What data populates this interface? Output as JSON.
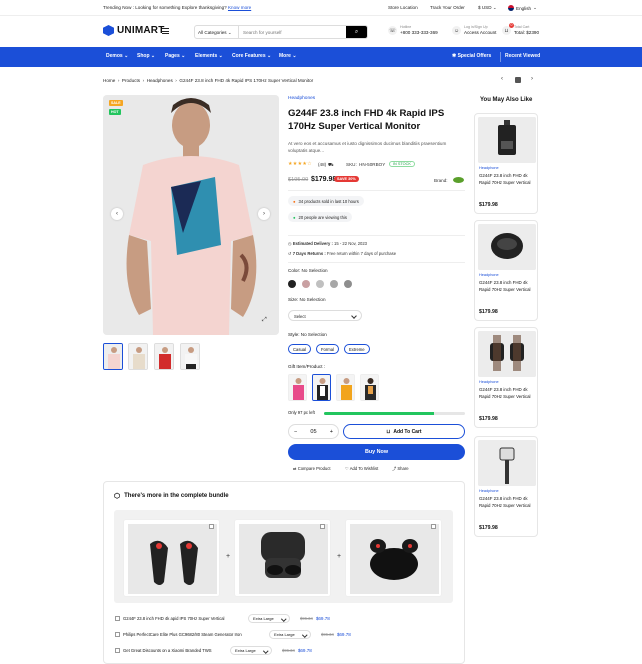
{
  "topbar": {
    "trending": "Trending Now : Looking for something Explore thanksgiving?",
    "know_more": "Know more",
    "store_location": "Store Location",
    "track_order": "Track Your Order",
    "currency": "$ USD",
    "language": "English"
  },
  "header": {
    "logo": "UNIMART",
    "search_category": "All Categories",
    "search_placeholder": "Search for yourself",
    "hotline_label": "Hotline",
    "hotline_value": "+800 333-333-369",
    "account_label": "Log in/Sign Up",
    "account_value": "Access Account",
    "cart_label": "Total Cart",
    "cart_value": "Total: $2390",
    "cart_count": "0"
  },
  "nav": {
    "items": [
      "Demos",
      "Shop",
      "Pages",
      "Elements",
      "Core Features",
      "More"
    ],
    "special_offers": "Special Offers",
    "recent_viewed": "Recent Viewed"
  },
  "breadcrumb": [
    "Home",
    "Products",
    "Headphones",
    "G244F 23.8 inch FHD 4k Rapid IPS 170Hz Super Vertical Monitor"
  ],
  "gallery": {
    "tag_sale": "SALE",
    "tag_hot": "HOT"
  },
  "product": {
    "category": "Headphones",
    "title": "G244F 23.8 inch FHD 4k Rapid IPS 170Hz Super Vertical Monitor",
    "description": "At vero eos et accusamus et iusto dignissimos ducimus blanditiis praesentium voluptatis atque...",
    "rating_stars": "★★★★☆",
    "rating_count": "(48)",
    "sku_label": "SKU:",
    "sku": "HN-50RBOY",
    "stock": "IN STOCK",
    "old_price": "$195.00",
    "price": "$179.98",
    "save": "SAVE 30%",
    "brand_label": "Brand:",
    "sold_text": "34 products sold in last 10 hours",
    "viewing_text": "20 people are viewing this",
    "delivery_label": "Estimated Delivery :",
    "delivery_value": "15 - 22 Nov, 2023",
    "returns_label": "7 Days Returns :",
    "returns_value": "Free return within 7 days of purchase",
    "color_label": "Color:",
    "color_value": "No Selection",
    "colors": [
      "#222222",
      "#c9a0a2",
      "#c0c0c0",
      "#a7a7a7",
      "#8e8e8e"
    ],
    "size_label": "Size:",
    "size_value": "No Selection",
    "size_select": "Select",
    "style_label": "Style:",
    "style_value": "No Selection",
    "styles": [
      "Casual",
      "Formal",
      "Extreme"
    ],
    "gift_label": "Gift Item/Product :",
    "stock_left": "Only 97 pc left",
    "stock_progress": 0.78,
    "qty": "05",
    "add_to_cart": "Add To Cart",
    "buy_now": "Buy Now",
    "compare": "Compare Product",
    "wishlist": "Add To Wishlist",
    "share": "Share"
  },
  "sidebar": {
    "title": "You May Also Like",
    "items": [
      {
        "category": "Headphone",
        "name": "G244F 23.8 inch FHD 4k Rapid 70Hz Super Vertical",
        "price": "$179.98"
      },
      {
        "category": "Headphone",
        "name": "G244F 23.8 inch FHD 4k Rapid 70Hz Super Vertical",
        "price": "$179.98"
      },
      {
        "category": "Headphone",
        "name": "G244F 23.8 inch FHD 4k Rapid 70Hz Super Vertical",
        "price": "$179.98"
      },
      {
        "category": "Headphone",
        "name": "G244F 23.8 inch FHD 4k Rapid 70Hz Super Vertical",
        "price": "$179.98"
      }
    ]
  },
  "bundle": {
    "title": "There's more in the complete bundle",
    "rows": [
      {
        "name": "G244F 23.8 inch FHD 4k apid IPS 70Hz Super Vertical",
        "option": "Extra Large",
        "old": "$96.34",
        "new": "$69.78"
      },
      {
        "name": "Philips PerfectCare Elite Plus GC9682/80 Steam Generator Iron",
        "option": "Extra Large",
        "old": "$96.34",
        "new": "$69.78"
      },
      {
        "name": "Get Great Discounts on a Xiaomi Branded TWS",
        "option": "Extra Large",
        "old": "$96.34",
        "new": "$69.78"
      }
    ]
  }
}
